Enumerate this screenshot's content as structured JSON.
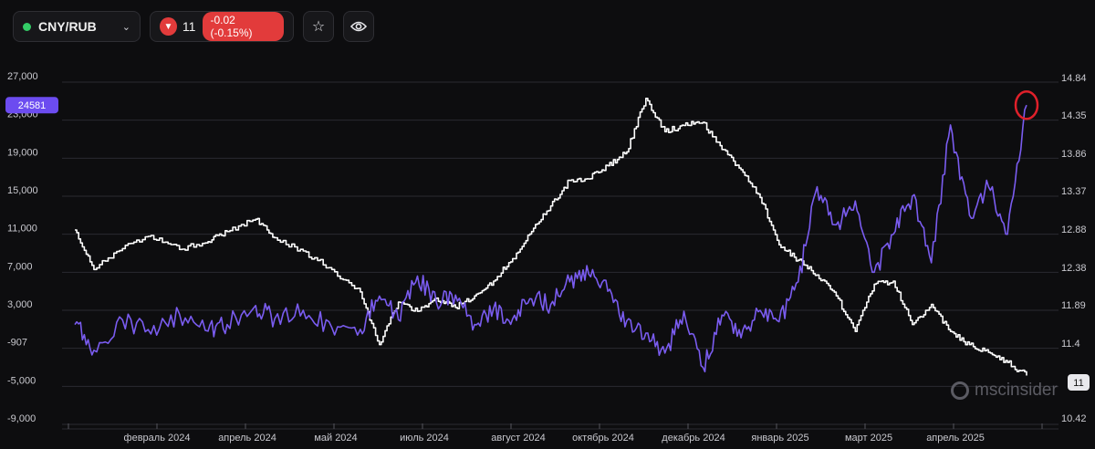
{
  "toolbar": {
    "symbol": "CNY/RUB",
    "last_value": "11",
    "change": "-0.02 (-0.15%)",
    "status_color": "#33cc66",
    "down_color": "#e23b3b",
    "icons": [
      "chevron-down-icon",
      "triangle-down-icon",
      "star-icon",
      "eye-icon"
    ]
  },
  "watermark": "mscinsider",
  "chart_data": {
    "type": "line",
    "x_labels": [
      "февраль 2024",
      "апрель 2024",
      "май 2024",
      "июль 2024",
      "август 2024",
      "октябрь 2024",
      "декабрь 2024",
      "январь 2025",
      "март 2025",
      "апрель 2025"
    ],
    "left_axis": {
      "ticks": [
        "27,000",
        "23,000",
        "19,000",
        "15,000",
        "11,000",
        "7,000",
        "3,000",
        "-907",
        "-5,000",
        "-9,000"
      ],
      "ylim": [
        -9000,
        27000
      ]
    },
    "right_axis": {
      "ticks": [
        "14.84",
        "14.35",
        "13.86",
        "13.37",
        "12.88",
        "12.38",
        "11.89",
        "11.4",
        "10.42"
      ],
      "ylim": [
        10.42,
        14.84
      ]
    },
    "left_marker": "24581",
    "right_marker": "11",
    "grid": true,
    "series": [
      {
        "axis": "right",
        "color": "#ffffff",
        "x": [
          0,
          0.02,
          0.05,
          0.08,
          0.11,
          0.14,
          0.16,
          0.19,
          0.21,
          0.24,
          0.27,
          0.3,
          0.32,
          0.34,
          0.36,
          0.38,
          0.4,
          0.42,
          0.44,
          0.46,
          0.48,
          0.5,
          0.52,
          0.54,
          0.56,
          0.58,
          0.6,
          0.62,
          0.64,
          0.66,
          0.68,
          0.7,
          0.72,
          0.74,
          0.76,
          0.78,
          0.8,
          0.82,
          0.84,
          0.86,
          0.88,
          0.9,
          0.92,
          0.94,
          0.96,
          0.98,
          1.0
        ],
        "values": [
          12.93,
          12.42,
          12.69,
          12.86,
          12.68,
          12.78,
          12.91,
          13.07,
          12.83,
          12.66,
          12.42,
          12.13,
          11.45,
          12.0,
          11.88,
          12.05,
          11.93,
          12.08,
          12.27,
          12.56,
          12.91,
          13.24,
          13.57,
          13.59,
          13.76,
          13.94,
          14.63,
          14.2,
          14.28,
          14.32,
          13.97,
          13.71,
          13.35,
          12.74,
          12.54,
          12.35,
          12.08,
          11.62,
          12.23,
          12.27,
          11.71,
          11.97,
          11.62,
          11.45,
          11.35,
          11.22,
          11.05
        ]
      },
      {
        "axis": "left",
        "color": "#7a5cf0",
        "x": [
          0,
          0.02,
          0.05,
          0.08,
          0.11,
          0.14,
          0.16,
          0.19,
          0.21,
          0.24,
          0.27,
          0.3,
          0.32,
          0.34,
          0.36,
          0.38,
          0.4,
          0.42,
          0.44,
          0.46,
          0.48,
          0.5,
          0.52,
          0.54,
          0.56,
          0.58,
          0.6,
          0.62,
          0.64,
          0.66,
          0.68,
          0.7,
          0.72,
          0.74,
          0.76,
          0.78,
          0.8,
          0.82,
          0.84,
          0.86,
          0.88,
          0.9,
          0.92,
          0.94,
          0.96,
          0.98,
          1.0
        ],
        "values": [
          1500,
          -1200,
          2000,
          500,
          2600,
          800,
          1500,
          3500,
          2100,
          3000,
          1200,
          1000,
          4500,
          2000,
          6600,
          3800,
          4600,
          1500,
          3200,
          2100,
          4200,
          3600,
          6000,
          6800,
          5000,
          1900,
          600,
          -1500,
          2900,
          -3000,
          2500,
          100,
          3000,
          1800,
          6000,
          16000,
          12000,
          14500,
          7000,
          11000,
          15000,
          8000,
          22500,
          13000,
          16000,
          11000,
          24581
        ]
      }
    ]
  }
}
